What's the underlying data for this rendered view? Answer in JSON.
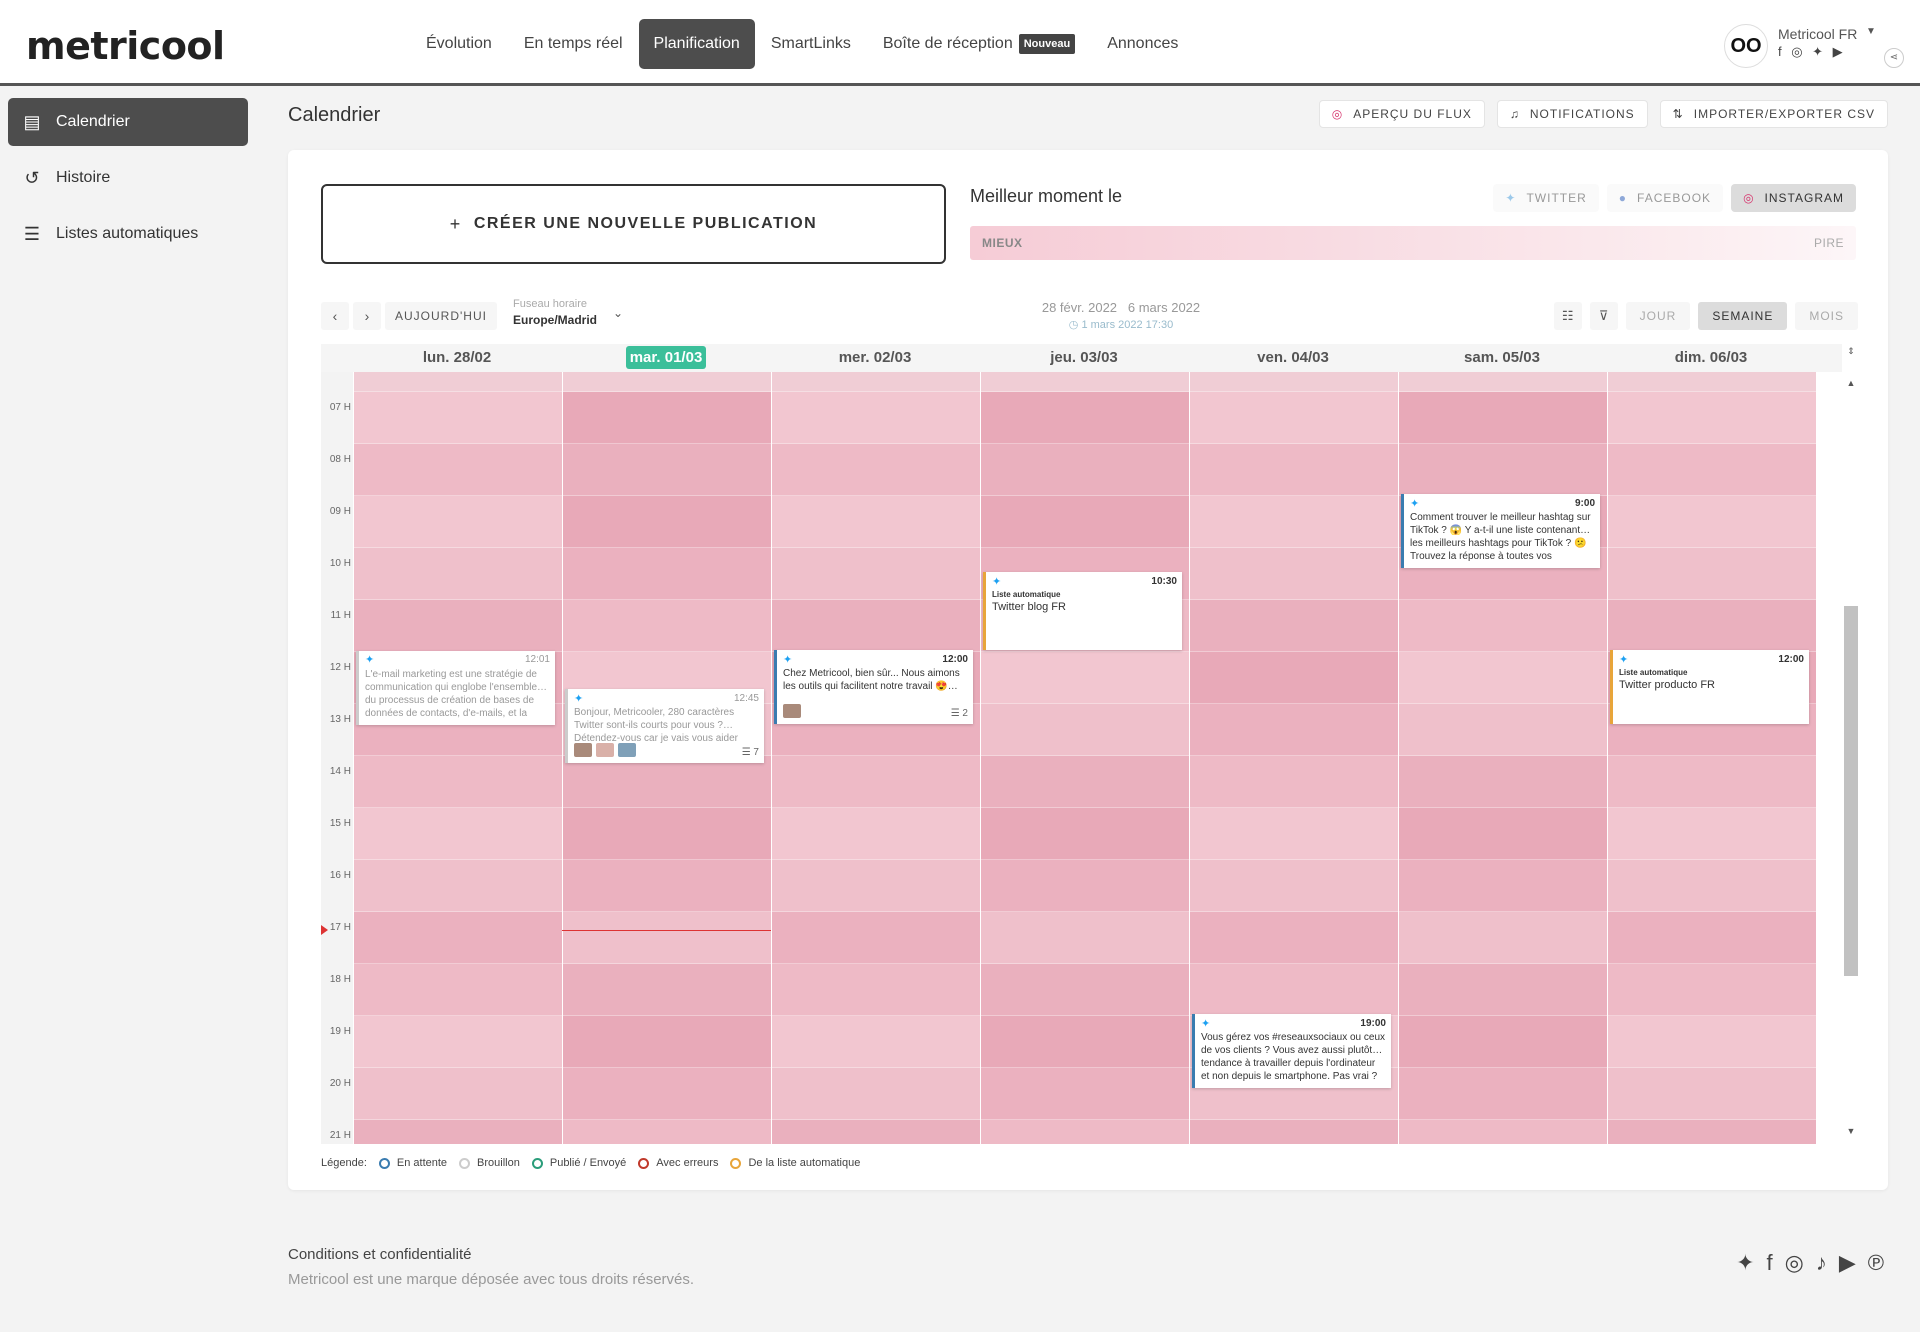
{
  "header": {
    "logo": "metricool",
    "nav": [
      "Évolution",
      "En temps réel",
      "Planification",
      "SmartLinks",
      "Boîte de réception",
      "Annonces"
    ],
    "nav_badge": "Nouveau",
    "account_name": "Metricool FR",
    "account_avatar": "OO",
    "account_socials": "f ◎ ✦ ▶"
  },
  "sidebar": {
    "items": [
      {
        "label": "Calendrier",
        "icon": "calendar-icon"
      },
      {
        "label": "Histoire",
        "icon": "history-icon"
      },
      {
        "label": "Listes automatiques",
        "icon": "list-icon"
      }
    ]
  },
  "page": {
    "title": "Calendrier",
    "actions": [
      "APERÇU DU FLUX",
      "NOTIFICATIONS",
      "IMPORTER/EXPORTER CSV"
    ]
  },
  "create": {
    "label": "CRÉER UNE NOUVELLE PUBLICATION"
  },
  "best_time": {
    "title": "Meilleur moment le",
    "networks": [
      "TWITTER",
      "FACEBOOK",
      "INSTAGRAM"
    ],
    "active_network": "INSTAGRAM",
    "scale_best": "MIEUX",
    "scale_worst": "PIRE"
  },
  "toolbar": {
    "prev": "‹",
    "next": "›",
    "today": "AUJOURD'HUI",
    "tz_label": "Fuseau horaire",
    "tz_value": "Europe/Madrid",
    "range_start": "28 févr. 2022",
    "range_end": "6 mars 2022",
    "now": "1 mars 2022 17:30",
    "views": [
      "JOUR",
      "SEMAINE",
      "MOIS"
    ],
    "active_view": "SEMAINE"
  },
  "calendar": {
    "days": [
      "lun. 28/02",
      "mar. 01/03",
      "mer. 02/03",
      "jeu. 03/03",
      "ven. 04/03",
      "sam. 05/03",
      "dim. 06/03"
    ],
    "today_index": 1,
    "hours": [
      "07 H",
      "08 H",
      "09 H",
      "10 H",
      "11 H",
      "12 H",
      "13 H",
      "14 H",
      "15 H",
      "16 H",
      "17 H",
      "18 H",
      "19 H",
      "20 H",
      "21 H"
    ],
    "posts": [
      {
        "day": 0,
        "time": "12:01",
        "text": "L'e-mail marketing est une stratégie de communication qui englobe l'ensemble… du processus de création de bases de données de contacts, d'e-mails, et la",
        "status": "draft"
      },
      {
        "day": 1,
        "time": "12:45",
        "text": "Bonjour, Metricooler, 280 caractères Twitter sont-ils courts pour vous ?… Détendez-vous car je vais vous aider",
        "status": "draft",
        "count": "7"
      },
      {
        "day": 2,
        "time": "12:00",
        "text": "Chez Metricool, bien sûr... Nous aimons les outils qui facilitent notre travail 😍…",
        "status": "pending",
        "count": "2"
      },
      {
        "day": 3,
        "time": "10:30",
        "label": "Liste automatique",
        "name": "Twitter blog FR",
        "status": "auto"
      },
      {
        "day": 4,
        "time": "19:00",
        "text": "Vous gérez vos #reseauxsociaux ou ceux de vos clients ?  Vous avez aussi plutôt… tendance à travailler depuis l'ordinateur et non depuis le smartphone. Pas vrai ? 📲",
        "status": "pending"
      },
      {
        "day": 5,
        "time": "9:00",
        "text": "Comment trouver le meilleur hashtag sur TikTok ? 😱 Y a-t-il une liste contenant… les meilleurs hashtags pour TikTok ? 😕 Trouvez la réponse à toutes vos",
        "status": "pending"
      },
      {
        "day": 6,
        "time": "12:00",
        "label": "Liste automatique",
        "name": "Twitter producto FR",
        "status": "auto"
      }
    ]
  },
  "legend": {
    "title": "Légende:",
    "items": [
      {
        "label": "En attente",
        "color": "#3a7cb0"
      },
      {
        "label": "Brouillon",
        "color": "#cccccc"
      },
      {
        "label": "Publié / Envoyé",
        "color": "#2a9d7a"
      },
      {
        "label": "Avec erreurs",
        "color": "#c0392b"
      },
      {
        "label": "De la liste automatique",
        "color": "#e8a53a"
      }
    ]
  },
  "footer": {
    "title": "Conditions et confidentialité",
    "sub": "Metricool est une marque déposée avec tous droits réservés."
  },
  "colors": {
    "accent": "#4d4d4d",
    "today": "#3bbf9a",
    "heat": "#e8a3b3"
  }
}
